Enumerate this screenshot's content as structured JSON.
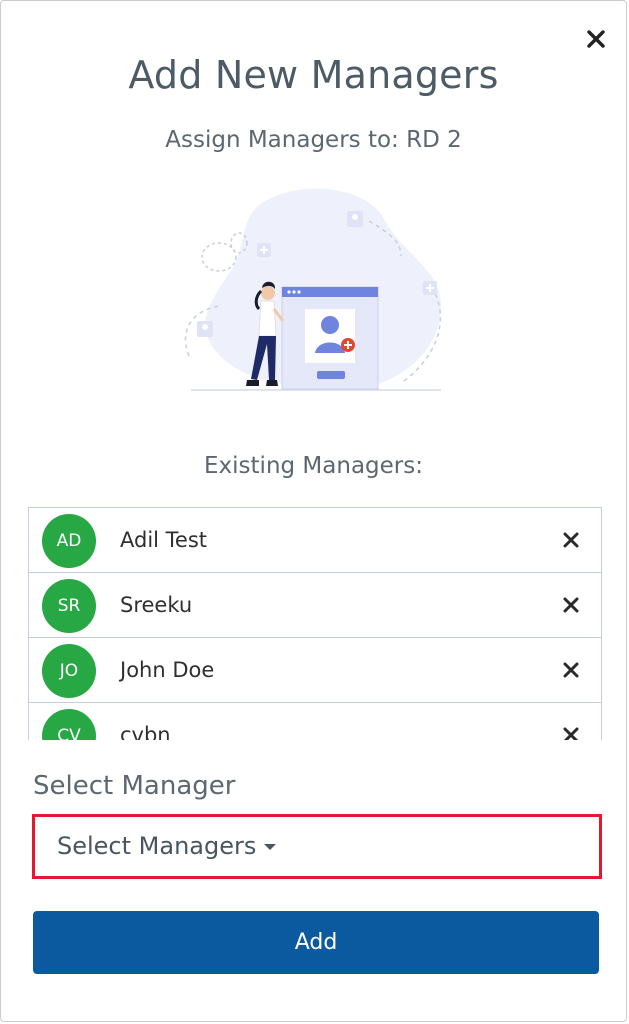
{
  "modal": {
    "title": "Add New Managers",
    "subtitle": "Assign Managers to: RD 2",
    "close_icon": "close-icon"
  },
  "existing": {
    "label": "Existing Managers:",
    "managers": [
      {
        "initials": "AD",
        "name": "Adil Test"
      },
      {
        "initials": "SR",
        "name": "Sreeku"
      },
      {
        "initials": "JO",
        "name": "John Doe"
      },
      {
        "initials": "CV",
        "name": "cvbn"
      }
    ]
  },
  "select": {
    "label": "Select Manager",
    "placeholder": "Select Managers"
  },
  "actions": {
    "add_label": "Add"
  },
  "colors": {
    "avatar": "#28a745",
    "primary": "#0b5aa0",
    "highlight_border": "#e3192f",
    "title": "#4c5b66"
  }
}
